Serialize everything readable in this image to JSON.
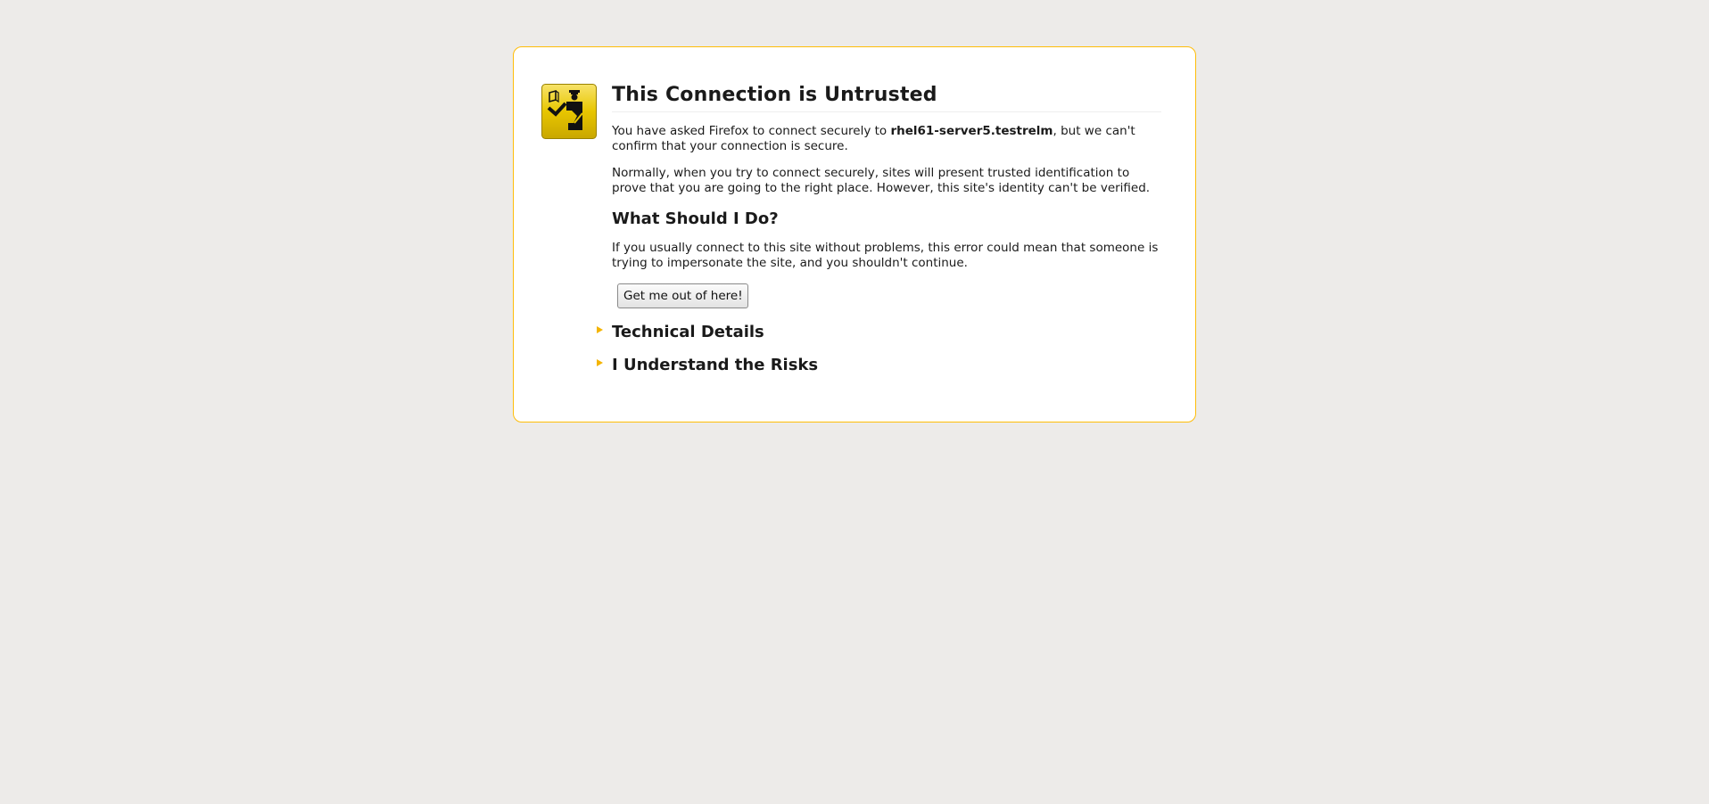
{
  "page": {
    "title": "This Connection is Untrusted",
    "intro": {
      "before": "You have asked Firefox to connect securely to ",
      "host": "rhel61-server5.testrelm",
      "after": ", but we can't confirm that your connection is secure."
    },
    "explanation": "Normally, when you try to connect securely, sites will present trusted identification to prove that you are going to the right place. However, this site's identity can't be verified.",
    "what_heading": "What Should I Do?",
    "advice": "If you usually connect to this site without problems, this error could mean that someone is trying to impersonate the site, and you shouldn't continue.",
    "escape_button": "Get me out of here!",
    "technical_details": "Technical Details",
    "understand_risks": "I Understand the Risks"
  },
  "icons": {
    "cert_error": "certificate-error-icon",
    "expander": "triangle-right-icon"
  },
  "colors": {
    "background": "#edebe9",
    "border": "#ffbd09",
    "icon_yellow": "#e8c600",
    "arrow": "#f4b400"
  }
}
